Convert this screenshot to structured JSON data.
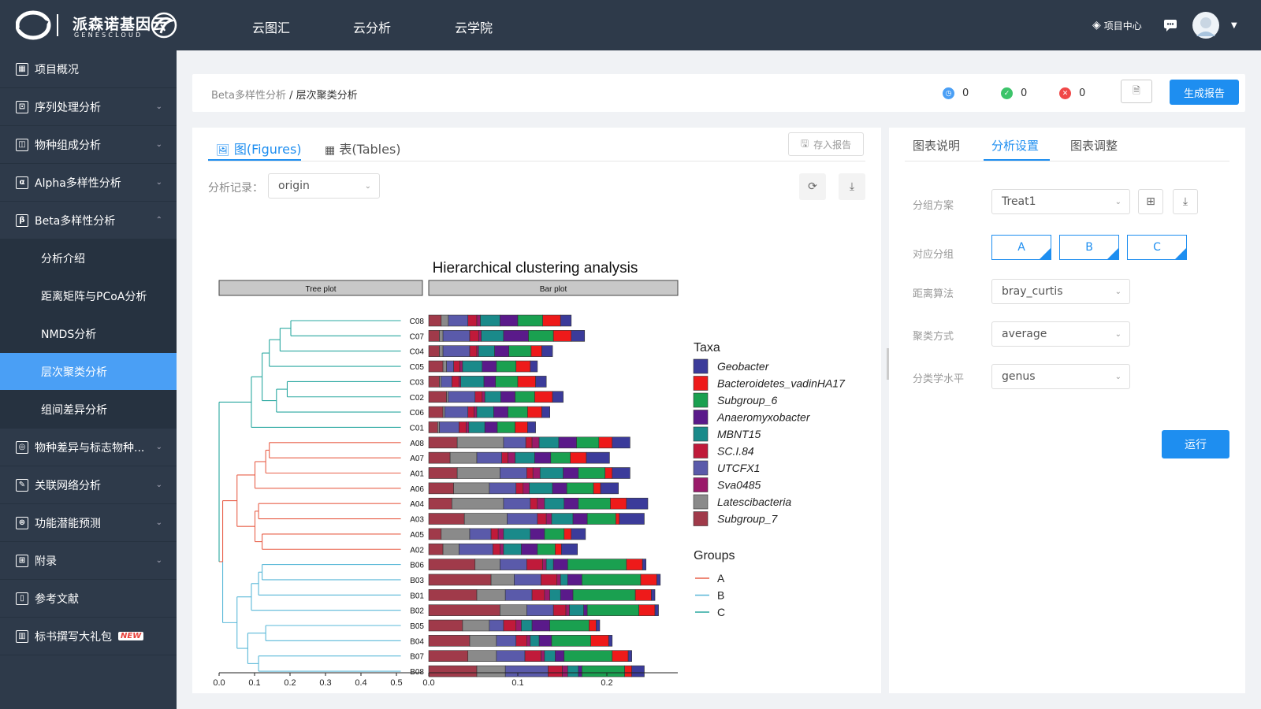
{
  "brand": {
    "name": "派森诺基因云",
    "sub": "GENESCLOUD"
  },
  "nav": [
    "云图汇",
    "云分析",
    "云学院"
  ],
  "topright": {
    "project_center": "项目中心"
  },
  "sidebar": {
    "items": [
      {
        "label": "项目概况",
        "icon": "grid-icon",
        "glyph": "▦"
      },
      {
        "label": "序列处理分析",
        "icon": "doc-icon",
        "glyph": "⊡"
      },
      {
        "label": "物种组成分析",
        "icon": "chart-icon",
        "glyph": "◫"
      },
      {
        "label": "Alpha多样性分析",
        "icon": "alpha-icon",
        "glyph": "α"
      },
      {
        "label": "Beta多样性分析",
        "icon": "beta-icon",
        "glyph": "β"
      }
    ],
    "sub": [
      "分析介绍",
      "距离矩阵与PCoA分析",
      "NMDS分析",
      "层次聚类分析",
      "组间差异分析"
    ],
    "items2": [
      {
        "label": "物种差异与标志物种...",
        "icon": "target-icon",
        "glyph": "◎"
      },
      {
        "label": "关联网络分析",
        "icon": "edit-icon",
        "glyph": "✎"
      },
      {
        "label": "功能潜能预测",
        "icon": "function-icon",
        "glyph": "⊛"
      },
      {
        "label": "附录",
        "icon": "appendix-icon",
        "glyph": "⊞"
      },
      {
        "label": "参考文献",
        "icon": "book-icon",
        "glyph": "▯"
      },
      {
        "label": "标书撰写大礼包",
        "icon": "gift-icon",
        "glyph": "▥"
      }
    ],
    "new_tag": "NEW"
  },
  "breadcrumb": {
    "parent": "Beta多样性分析",
    "sep": " / ",
    "current": "层次聚类分析"
  },
  "status": {
    "running": "0",
    "success": "0",
    "failed": "0"
  },
  "colors": {
    "running": "#4a9ff5",
    "success": "#3cc46a",
    "failed": "#f04848",
    "accent": "#1e8ef0"
  },
  "buttons": {
    "generate_report": "生成报告",
    "save_report": "存入报告",
    "run": "运行"
  },
  "left_tabs": {
    "figures": "图(Figures)",
    "tables": "表(Tables)"
  },
  "analysis_record": {
    "label": "分析记录：",
    "value": "origin"
  },
  "right_tabs": [
    "图表说明",
    "分析设置",
    "图表调整"
  ],
  "settings": {
    "group_scheme": {
      "label": "分组方案",
      "value": "Treat1"
    },
    "groups": {
      "label": "对应分组",
      "options": [
        "A",
        "B",
        "C"
      ]
    },
    "distance": {
      "label": "距离算法",
      "value": "bray_curtis"
    },
    "cluster": {
      "label": "聚类方式",
      "value": "average"
    },
    "taxon": {
      "label": "分类学水平",
      "value": "genus"
    }
  },
  "chart_data": {
    "type": "dendrogram-stacked-bar",
    "title": "Hierarchical clustering analysis",
    "panels": [
      "Tree plot",
      "Bar plot"
    ],
    "tree_axis_ticks": [
      "0.0",
      "0.1",
      "0.2",
      "0.3",
      "0.4",
      "0.5"
    ],
    "bar_axis_ticks": [
      "0.0",
      "0.1",
      "0.2"
    ],
    "samples": [
      "C08",
      "C07",
      "C04",
      "C05",
      "C03",
      "C02",
      "C06",
      "C01",
      "A08",
      "A07",
      "A01",
      "A06",
      "A04",
      "A03",
      "A05",
      "A02",
      "B06",
      "B03",
      "B01",
      "B02",
      "B05",
      "B04",
      "B07",
      "B08"
    ],
    "sample_groups": [
      "C",
      "C",
      "C",
      "C",
      "C",
      "C",
      "C",
      "C",
      "A",
      "A",
      "A",
      "A",
      "A",
      "A",
      "A",
      "A",
      "B",
      "B",
      "B",
      "B",
      "B",
      "B",
      "B",
      "B"
    ],
    "taxa_legend_title": "Taxa",
    "taxa": [
      "Geobacter",
      "Bacteroidetes_vadinHA17",
      "Subgroup_6",
      "Anaeromyxobacter",
      "MBNT15",
      "SC.I.84",
      "UTCFX1",
      "Sva0485",
      "Latescibacteria",
      "Subgroup_7"
    ],
    "taxa_colors": [
      "#3b3b9a",
      "#ee1a1a",
      "#1aa050",
      "#5a1a8a",
      "#1a8a8a",
      "#c01a3a",
      "#5a5aaa",
      "#9a1a6a",
      "#8a8a8a",
      "#a03a4a"
    ],
    "groups_legend_title": "Groups",
    "groups": [
      "A",
      "B",
      "C"
    ],
    "group_colors": [
      "#e8604a",
      "#5ab8d8",
      "#2aa8a0"
    ],
    "bar_xlim": [
      0,
      0.28
    ],
    "bar_order": [
      9,
      8,
      6,
      5,
      7,
      4,
      3,
      2,
      1,
      0
    ],
    "bar_values": [
      [
        0.012,
        0.02,
        0.028,
        0.02,
        0.022,
        0.01,
        0.022,
        0.004,
        0.008,
        0.014
      ],
      [
        0.015,
        0.02,
        0.028,
        0.028,
        0.025,
        0.01,
        0.03,
        0.003,
        0.004,
        0.012
      ],
      [
        0.012,
        0.012,
        0.025,
        0.016,
        0.018,
        0.008,
        0.03,
        0.002,
        0.004,
        0.012
      ],
      [
        0.008,
        0.016,
        0.022,
        0.016,
        0.022,
        0.007,
        0.008,
        0.003,
        0.004,
        0.016
      ],
      [
        0.012,
        0.02,
        0.025,
        0.013,
        0.026,
        0.008,
        0.012,
        0.002,
        0.002,
        0.012
      ],
      [
        0.012,
        0.02,
        0.022,
        0.016,
        0.018,
        0.008,
        0.03,
        0.003,
        0.002,
        0.02
      ],
      [
        0.009,
        0.016,
        0.022,
        0.016,
        0.019,
        0.007,
        0.026,
        0.003,
        0.002,
        0.016
      ],
      [
        0.009,
        0.014,
        0.02,
        0.014,
        0.018,
        0.008,
        0.022,
        0.003,
        0.002,
        0.01
      ],
      [
        0.02,
        0.015,
        0.025,
        0.02,
        0.022,
        0.007,
        0.025,
        0.008,
        0.052,
        0.032
      ],
      [
        0.026,
        0.018,
        0.022,
        0.018,
        0.022,
        0.007,
        0.028,
        0.008,
        0.03,
        0.024
      ],
      [
        0.02,
        0.008,
        0.03,
        0.017,
        0.026,
        0.007,
        0.03,
        0.008,
        0.048,
        0.032
      ],
      [
        0.02,
        0.008,
        0.03,
        0.016,
        0.026,
        0.008,
        0.03,
        0.007,
        0.04,
        0.028
      ],
      [
        0.024,
        0.018,
        0.036,
        0.016,
        0.022,
        0.008,
        0.03,
        0.008,
        0.058,
        0.026
      ],
      [
        0.028,
        0.004,
        0.032,
        0.016,
        0.024,
        0.01,
        0.034,
        0.006,
        0.048,
        0.04
      ],
      [
        0.016,
        0.008,
        0.022,
        0.016,
        0.03,
        0.008,
        0.024,
        0.006,
        0.032,
        0.014
      ],
      [
        0.018,
        0.007,
        0.02,
        0.018,
        0.02,
        0.008,
        0.038,
        0.004,
        0.018,
        0.016
      ],
      [
        0.004,
        0.018,
        0.066,
        0.016,
        0.008,
        0.018,
        0.03,
        0.004,
        0.028,
        0.052
      ],
      [
        0.004,
        0.018,
        0.066,
        0.016,
        0.008,
        0.018,
        0.03,
        0.004,
        0.026,
        0.07
      ],
      [
        0.004,
        0.018,
        0.07,
        0.014,
        0.012,
        0.014,
        0.03,
        0.006,
        0.032,
        0.054
      ],
      [
        0.004,
        0.018,
        0.058,
        0.004,
        0.016,
        0.014,
        0.03,
        0.004,
        0.03,
        0.08
      ],
      [
        0.004,
        0.008,
        0.044,
        0.02,
        0.012,
        0.014,
        0.016,
        0.006,
        0.03,
        0.038
      ],
      [
        0.004,
        0.02,
        0.044,
        0.014,
        0.01,
        0.012,
        0.022,
        0.004,
        0.03,
        0.046
      ],
      [
        0.004,
        0.018,
        0.054,
        0.01,
        0.012,
        0.018,
        0.032,
        0.004,
        0.032,
        0.044
      ],
      [
        0.014,
        0.008,
        0.048,
        0.004,
        0.012,
        0.016,
        0.048,
        0.006,
        0.032,
        0.054
      ]
    ]
  }
}
